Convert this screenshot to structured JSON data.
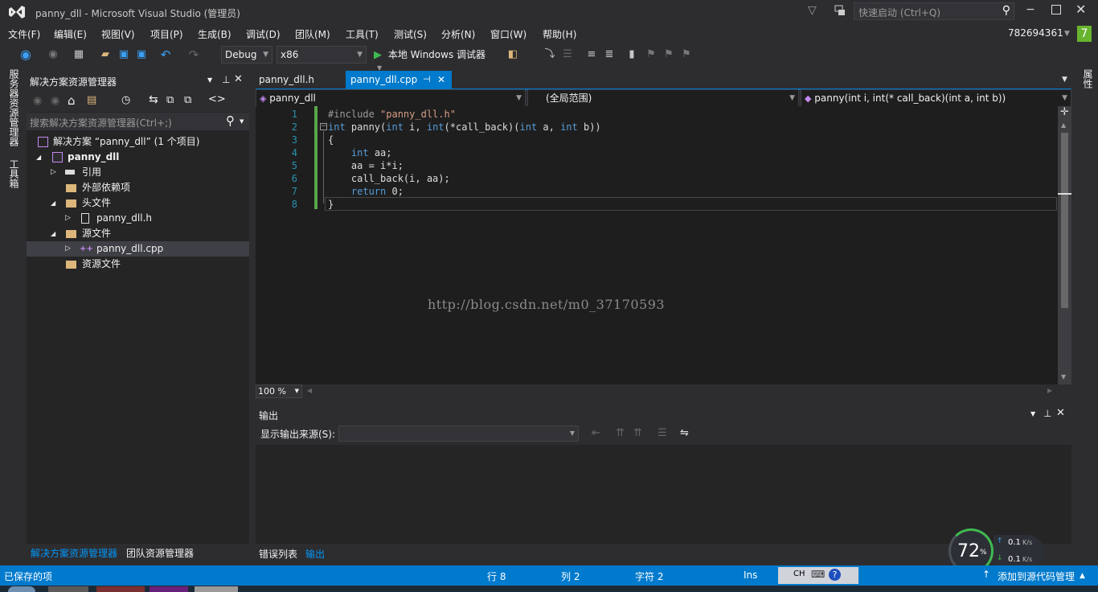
{
  "window": {
    "title": "panny_dll - Microsoft Visual Studio (管理员)",
    "quick_launch_placeholder": "快速启动 (Ctrl+Q)",
    "user": "782694361",
    "notif_count": "7"
  },
  "menu": [
    "文件(F)",
    "编辑(E)",
    "视图(V)",
    "项目(P)",
    "生成(B)",
    "调试(D)",
    "团队(M)",
    "工具(T)",
    "测试(S)",
    "分析(N)",
    "窗口(W)",
    "帮助(H)"
  ],
  "toolbar": {
    "config": "Debug",
    "platform": "x86",
    "run_label": "本地 Windows 调试器"
  },
  "left_strip": {
    "server_explorer": "服务器资源管理器",
    "toolbox": "工具箱"
  },
  "right_strip": {
    "label": "属性"
  },
  "solution_panel": {
    "title": "解决方案资源管理器",
    "search_placeholder": "搜索解决方案资源管理器(Ctrl+;)",
    "items": [
      {
        "label": "解决方案 “panny_dll” (1 个项目)"
      },
      {
        "label": "panny_dll"
      },
      {
        "label": "引用"
      },
      {
        "label": "外部依赖项"
      },
      {
        "label": "头文件"
      },
      {
        "label": "panny_dll.h"
      },
      {
        "label": "源文件"
      },
      {
        "label": "panny_dll.cpp"
      },
      {
        "label": "资源文件"
      }
    ],
    "bottom_tabs": [
      "解决方案资源管理器",
      "团队资源管理器"
    ]
  },
  "editor": {
    "tabs": [
      "panny_dll.h",
      "panny_dll.cpp"
    ],
    "nav": {
      "project": "panny_dll",
      "scope": "(全局范围)",
      "member": "panny(int i, int(* call_back)(int a, int b))"
    },
    "line_numbers": [
      "1",
      "2",
      "3",
      "4",
      "5",
      "6",
      "7",
      "8"
    ],
    "code": {
      "l1_pp": "#include ",
      "l1_str": "\"panny_dll.h\"",
      "l2_kw1": "int",
      "l2_a": " panny(",
      "l2_kw2": "int",
      "l2_b": " i, ",
      "l2_kw3": "int",
      "l2_c": "(*call_back)(",
      "l2_kw4": "int",
      "l2_d": " a, ",
      "l2_kw5": "int",
      "l2_e": " b))",
      "l3": "{",
      "l4_kw": "int",
      "l4_b": " aa;",
      "l5": "    aa = i*i;",
      "l6": "    call_back(i, aa);",
      "l7_kw": "return",
      "l7_b": " 0;",
      "l8": "}"
    },
    "watermark": "http://blog.csdn.net/m0_37170593",
    "zoom": "100 %"
  },
  "output": {
    "title": "输出",
    "source_label": "显示输出来源(S):",
    "source_value": "",
    "bottom_tabs": [
      "错误列表",
      "输出"
    ]
  },
  "status": {
    "left": "已保存的项",
    "line": "行 8",
    "col": "列 2",
    "char": "字符 2",
    "mode": "Ins",
    "ime": "CH",
    "source_control": "添加到源代码管理"
  },
  "net_widget": {
    "percent": "72",
    "unit": "%",
    "up": "0.1",
    "down": "0.1",
    "rate_unit": "K/s"
  },
  "colors": {
    "accent": "#007acc",
    "bg": "#2d2d30",
    "editor_bg": "#1e1e1e",
    "keyword": "#569cd6",
    "string": "#d69d85",
    "line_number": "#2b91af"
  }
}
